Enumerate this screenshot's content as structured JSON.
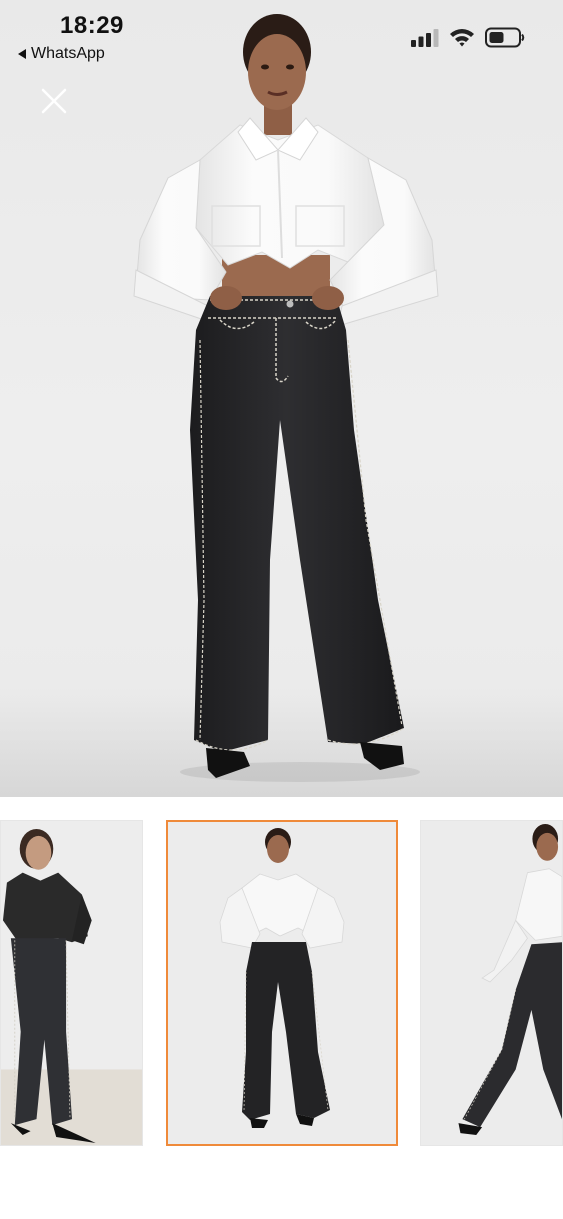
{
  "status_bar": {
    "time": "18:29",
    "back_label": "WhatsApp",
    "icons": [
      "signal-icon",
      "wifi-icon",
      "battery-icon"
    ]
  },
  "viewer": {
    "close_icon": "close-icon",
    "image_description_icon": "product-photo",
    "background_color": "#ececec"
  },
  "thumbnails": {
    "selected_index": 1,
    "selected_border_color": "#ef8a3a",
    "items": [
      {
        "name": "thumbnail-1"
      },
      {
        "name": "thumbnail-2"
      },
      {
        "name": "thumbnail-3"
      }
    ]
  },
  "colors": {
    "shirt": "#f7f7f7",
    "jeans": "#232325",
    "stitching": "#d8d4c8",
    "skin": "#9b6a4f",
    "hair": "#2a1c16"
  }
}
